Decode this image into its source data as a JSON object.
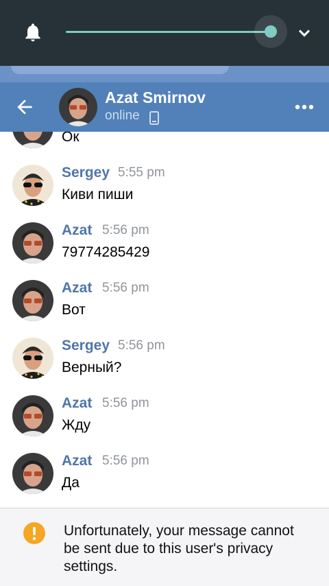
{
  "volume_panel": {
    "level": 0.96,
    "accent": "#80cbc4",
    "icons": [
      "bell-icon",
      "chevron-down-icon"
    ]
  },
  "header": {
    "name": "Azat Smirnov",
    "status": "online",
    "icons": [
      "back-arrow-icon",
      "phone-icon",
      "more-icon"
    ],
    "color": "#5181b8"
  },
  "messages": [
    {
      "author": "",
      "time": "",
      "text": "Ок",
      "avatar": "azat",
      "partial": true
    },
    {
      "author": "Sergey",
      "time": "5:55 pm",
      "text": "Киви пиши",
      "avatar": "sergey"
    },
    {
      "author": "Azat",
      "time": "5:56 pm",
      "text": "79774285429",
      "avatar": "azat"
    },
    {
      "author": "Azat",
      "time": "5:56 pm",
      "text": "Вот",
      "avatar": "azat"
    },
    {
      "author": "Sergey",
      "time": "5:56 pm",
      "text": "Верный?",
      "avatar": "sergey"
    },
    {
      "author": "Azat",
      "time": "5:56 pm",
      "text": "Жду",
      "avatar": "azat"
    },
    {
      "author": "Azat",
      "time": "5:56 pm",
      "text": "Да",
      "avatar": "azat"
    }
  ],
  "notice": {
    "text": "Unfortunately, your message cannot be sent due to this user's privacy settings.",
    "icon": "warning-icon",
    "color": "#f5a623"
  }
}
